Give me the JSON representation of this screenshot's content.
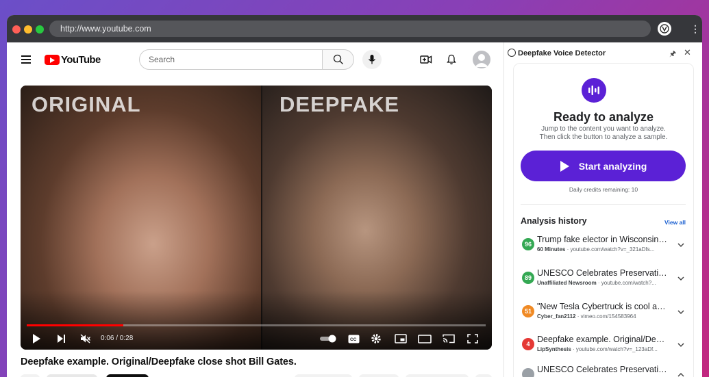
{
  "browser": {
    "url": "http://www.youtube.com",
    "traffic_colors": [
      "#ff5f57",
      "#febc2e",
      "#28c840"
    ]
  },
  "youtube": {
    "logo_text": "YouTube",
    "search_placeholder": "Search",
    "video": {
      "label_left": "ORIGINAL",
      "label_right": "DEEPFAKE",
      "time": "0:06 / 0:28",
      "progress": 0.21
    },
    "title": "Deepfake example. Original/Deepfake close shot Bill Gates."
  },
  "extension": {
    "name": "Deepfake Voice Detector",
    "accent": "#5b21d6",
    "heading": "Ready to analyze",
    "subtitle_line1": "Jump to the content you want to analyze.",
    "subtitle_line2": "Then click the button to analyze a sample.",
    "start_label": "Start analyzing",
    "credits": "Daily credits remaining: 10",
    "history_title": "Analysis history",
    "view_all": "View all",
    "history": [
      {
        "score": "96",
        "color": "#34a853",
        "title": "Trump fake elector in Wisconsin de...",
        "source": "60 Minutes",
        "url": "youtube.com/watch?v=_321aDfs..."
      },
      {
        "score": "89",
        "color": "#34a853",
        "title": "UNESCO Celebrates Preservation Ef...",
        "source": "Unaffiliated Newsroom",
        "url": "youtube.com/watch?..."
      },
      {
        "score": "51",
        "color": "#f08a24",
        "title": "\"New Tesla Cybertruck is cool and...",
        "source": "Cyber_fan2112",
        "url": "vimeo.com/154583964"
      },
      {
        "score": "4",
        "color": "#e53935",
        "title": "Deepfake example. Original/Deepfa...",
        "source": "LipSynthesis",
        "url": "youtube.com/watch?v=_123aDf..."
      },
      {
        "score": "",
        "color": "#9aa0a6",
        "title": "UNESCO Celebrates Preservation Ef...",
        "source": "",
        "url": ""
      }
    ]
  }
}
